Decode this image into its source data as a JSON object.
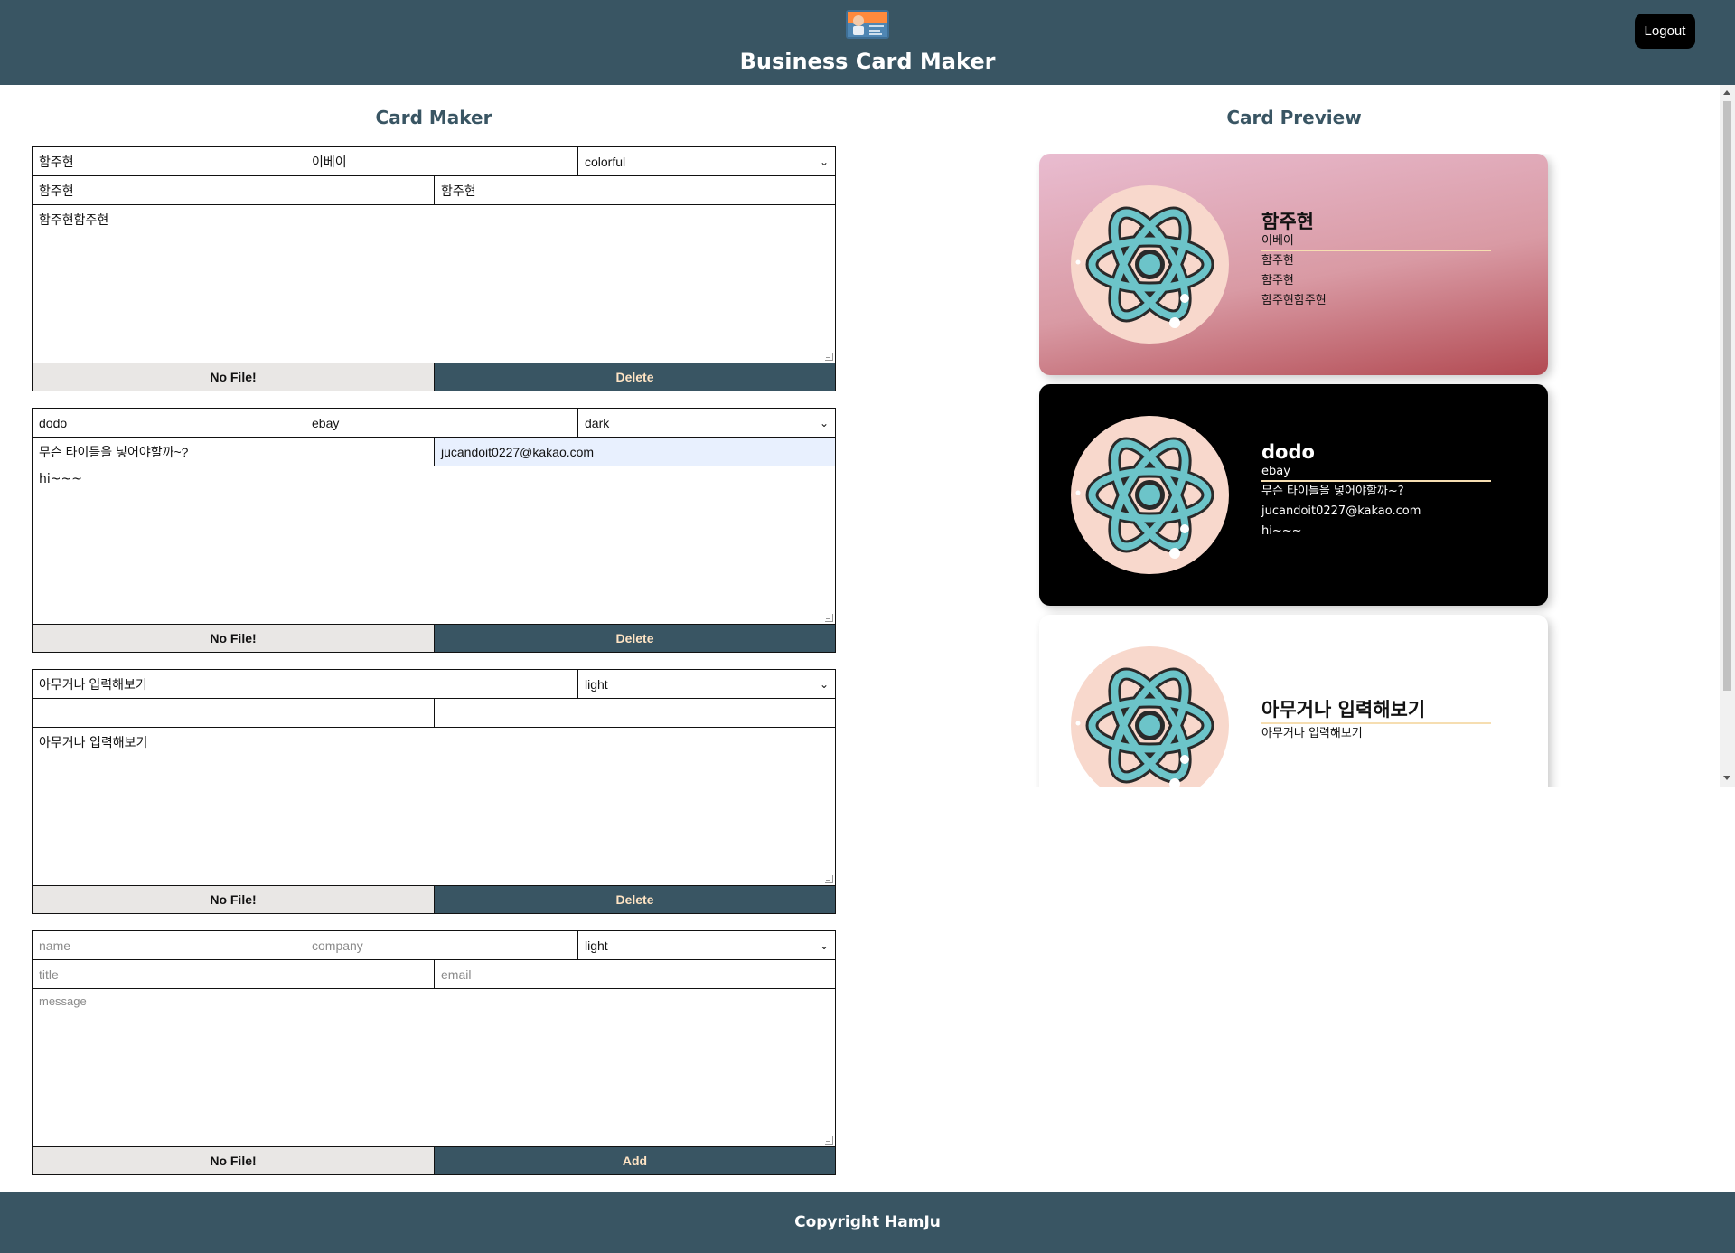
{
  "header": {
    "title": "Business Card Maker",
    "logout_label": "Logout"
  },
  "maker": {
    "title": "Card Maker",
    "forms": [
      {
        "name": "함주현",
        "company": "이베이",
        "theme": "colorful",
        "title": "함주현",
        "email": "함주현",
        "message": "함주현함주현",
        "file_label": "No File!",
        "action_label": "Delete"
      },
      {
        "name": "dodo",
        "company": "ebay",
        "theme": "dark",
        "title": "무슨 타이틀을 넣어야할까~?",
        "email": "jucandoit0227@kakao.com",
        "message": "hi~~~",
        "file_label": "No File!",
        "action_label": "Delete"
      },
      {
        "name": "아무거나 입력해보기",
        "company": "",
        "theme": "light",
        "title": "",
        "email": "",
        "message": "아무거나 입력해보기",
        "file_label": "No File!",
        "action_label": "Delete"
      }
    ],
    "add_form": {
      "theme": "light",
      "placeholders": {
        "name": "name",
        "company": "company",
        "title": "title",
        "email": "email",
        "message": "message"
      },
      "file_label": "No File!",
      "action_label": "Add"
    }
  },
  "preview": {
    "title": "Card Preview",
    "cards": [
      {
        "theme": "colorful",
        "name": "함주현",
        "company": "이베이",
        "title": "함주현",
        "email": "함주현",
        "message": "함주현함주현"
      },
      {
        "theme": "dark",
        "name": "dodo",
        "company": "ebay",
        "title": "무슨 타이틀을 넣어야할까~?",
        "email": "jucandoit0227@kakao.com",
        "message": "hi~~~"
      },
      {
        "theme": "light",
        "name": "아무거나 입력해보기",
        "company": "",
        "title": "",
        "email": "",
        "message": "아무거나 입력해보기"
      }
    ]
  },
  "footer": {
    "text": "Copyright HamJu"
  },
  "colors": {
    "primary": "#395563",
    "accent": "#ffe4c4",
    "file_button": "#e9e7e5",
    "avatar_bg": "#f8d8cc"
  },
  "icons": {
    "logo": "business-card-logo",
    "avatar": "atom-icon",
    "select": "chevron-down-icon"
  }
}
